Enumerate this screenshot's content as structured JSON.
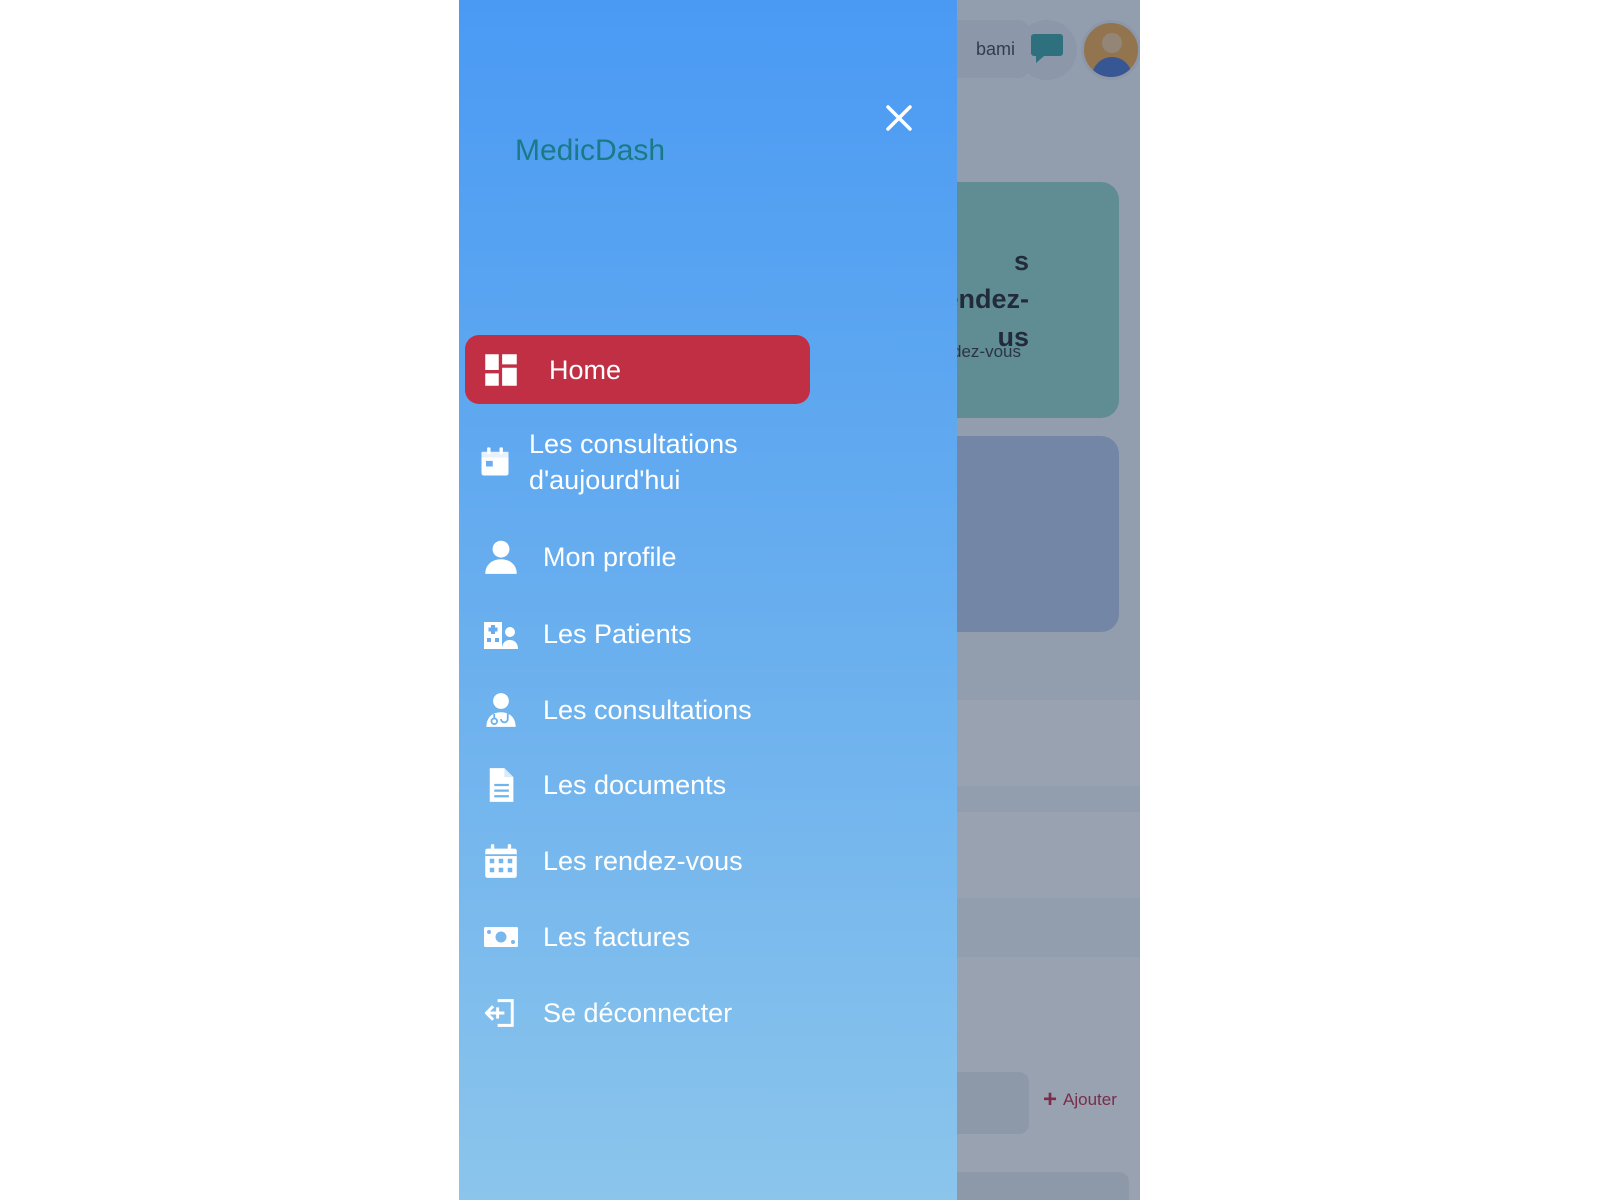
{
  "app": {
    "brand": "MedicDash"
  },
  "topbar": {
    "user_name_partial": "bami"
  },
  "background_cards": {
    "rdv_title": "s rendez-\nus",
    "rdv_subtitle": "Rendez-vous",
    "add_label": "Ajouter"
  },
  "sidebar": {
    "items": [
      {
        "label": "Home",
        "icon": "dashboard-grid-icon",
        "active": true
      },
      {
        "label": "Les consultations d'aujourd'hui",
        "icon": "calendar-day-icon",
        "active": false
      },
      {
        "label": "Mon profile",
        "icon": "user-icon",
        "active": false
      },
      {
        "label": "Les Patients",
        "icon": "hospital-user-icon",
        "active": false
      },
      {
        "label": "Les consultations",
        "icon": "doctor-icon",
        "active": false
      },
      {
        "label": "Les documents",
        "icon": "document-icon",
        "active": false
      },
      {
        "label": "Les rendez-vous",
        "icon": "calendar-icon",
        "active": false
      },
      {
        "label": "Les factures",
        "icon": "money-bill-icon",
        "active": false
      },
      {
        "label": "Se déconnecter",
        "icon": "logout-icon",
        "active": false
      }
    ]
  },
  "colors": {
    "active_item": "#c02f43",
    "sidebar_top": "#4a9af4",
    "sidebar_bottom": "#8bc5ec",
    "brand_text": "#1a7a86",
    "accent_red": "#c4122f"
  }
}
